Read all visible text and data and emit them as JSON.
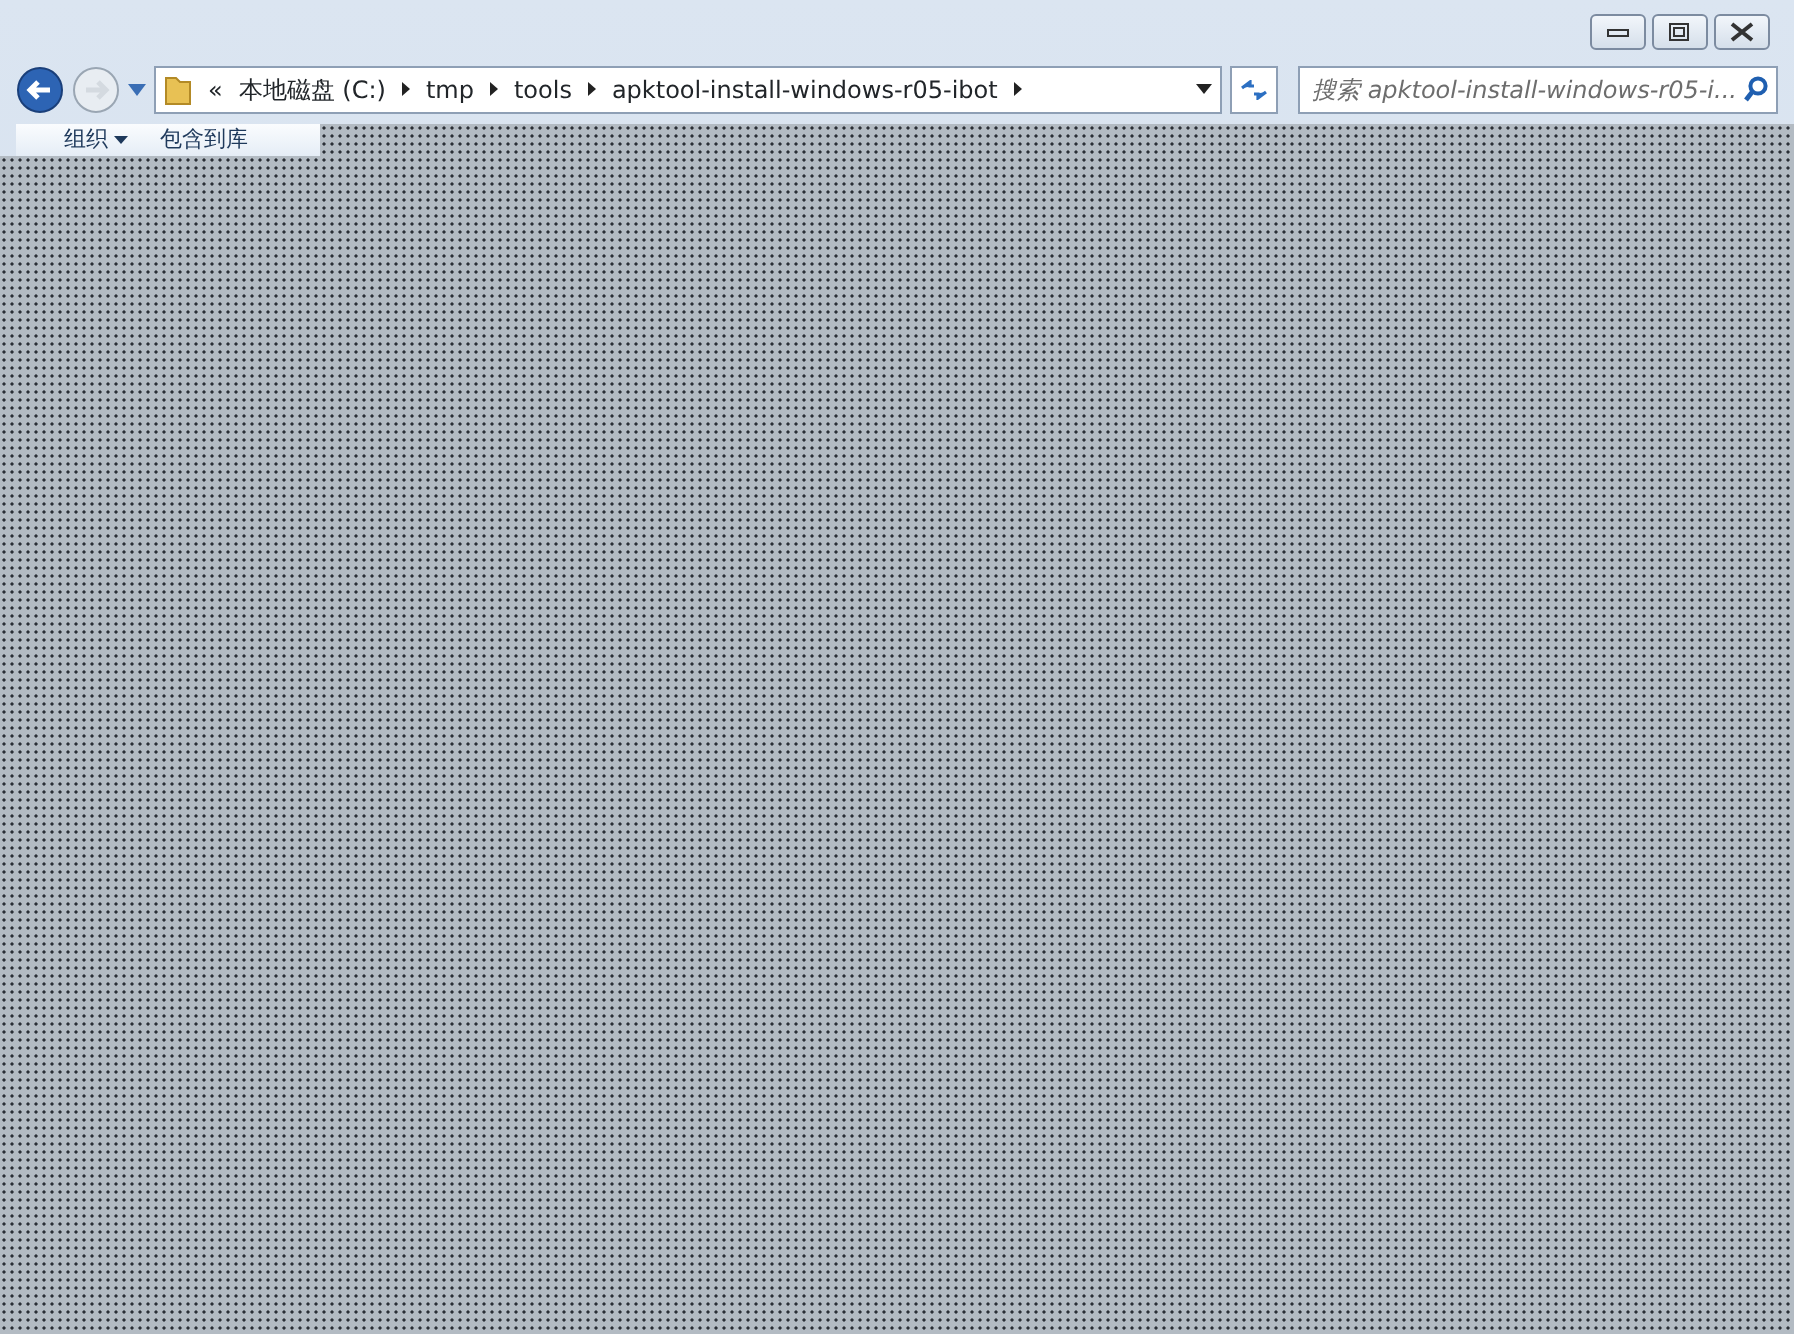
{
  "window": {
    "controls": [
      {
        "kind": "minimize"
      },
      {
        "kind": "maximize"
      },
      {
        "kind": "close"
      }
    ]
  },
  "nav": {
    "buttons": [
      {
        "kind": "back",
        "disabled": false
      },
      {
        "kind": "forward",
        "disabled": true
      }
    ]
  },
  "address": {
    "overflow": "«",
    "crumbs": [
      "本地磁盘 (C:)",
      "tmp",
      "tools",
      "apktool-install-windows-r05-ibot"
    ]
  },
  "search": {
    "placeholder": "搜索 apktool-install-windows-r05-i..."
  },
  "toolbar": {
    "items": [
      {
        "label": "组织",
        "dropdown": true
      },
      {
        "label": "包含到库",
        "dropdown": false
      }
    ]
  }
}
